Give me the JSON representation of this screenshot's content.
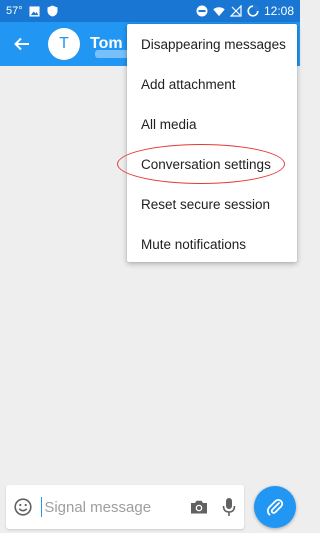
{
  "status_bar": {
    "temperature": "57°",
    "time": "12:08",
    "icons": [
      "image-icon",
      "shield-icon",
      "do-not-disturb-icon",
      "wifi-icon",
      "no-sim-icon",
      "battery-icon"
    ]
  },
  "header": {
    "avatar_initial": "T",
    "contact_name": "Tom",
    "accent_color": "#2196f3",
    "status_bar_color": "#1976d2"
  },
  "menu": {
    "items": [
      "Disappearing messages",
      "Add attachment",
      "All media",
      "Conversation settings",
      "Reset secure session",
      "Mute notifications"
    ],
    "highlighted_item": "Conversation settings",
    "highlight_color": "#e53935"
  },
  "composer": {
    "placeholder": "Signal message",
    "icons": [
      "emoji-icon",
      "camera-icon",
      "microphone-icon",
      "paperclip-icon"
    ]
  }
}
